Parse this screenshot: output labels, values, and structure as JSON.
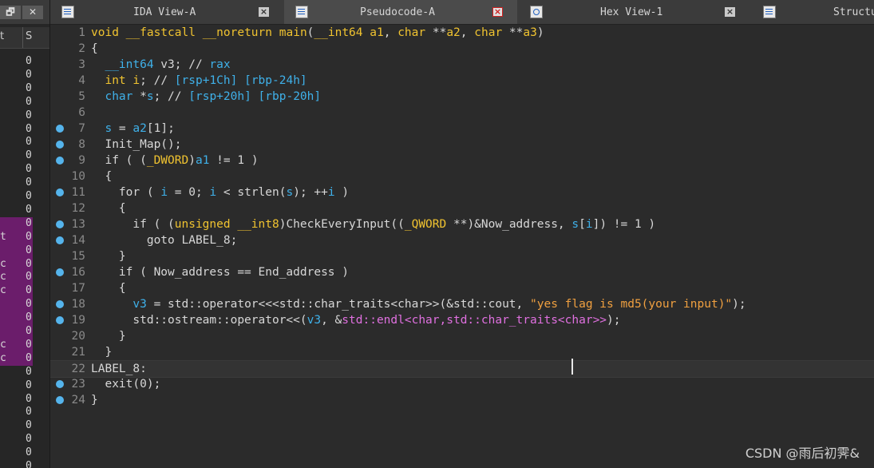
{
  "left_panel": {
    "btn1": "🗗",
    "btn2": "✕",
    "col_headers": [
      "t",
      "S"
    ],
    "rows": [
      {
        "c1": "",
        "c2": "0"
      },
      {
        "c1": "",
        "c2": "0"
      },
      {
        "c1": "",
        "c2": "0"
      },
      {
        "c1": "",
        "c2": "0"
      },
      {
        "c1": "",
        "c2": "0"
      },
      {
        "c1": "",
        "c2": "0"
      },
      {
        "c1": "",
        "c2": "0"
      },
      {
        "c1": "",
        "c2": "0"
      },
      {
        "c1": "",
        "c2": "0"
      },
      {
        "c1": "",
        "c2": "0"
      },
      {
        "c1": "",
        "c2": "0"
      },
      {
        "c1": "",
        "c2": "0"
      },
      {
        "c1": "",
        "c2": "0"
      },
      {
        "c1": "t",
        "c2": "0"
      },
      {
        "c1": "",
        "c2": "0"
      },
      {
        "c1": "c",
        "c2": "0"
      },
      {
        "c1": "c",
        "c2": "0"
      },
      {
        "c1": "c",
        "c2": "0"
      },
      {
        "c1": "",
        "c2": "0"
      },
      {
        "c1": "",
        "c2": "0"
      },
      {
        "c1": "",
        "c2": "0"
      },
      {
        "c1": "c",
        "c2": "0"
      },
      {
        "c1": "c",
        "c2": "0"
      },
      {
        "c1": "",
        "c2": "0"
      },
      {
        "c1": "",
        "c2": "0"
      },
      {
        "c1": "",
        "c2": "0"
      },
      {
        "c1": "",
        "c2": "0"
      },
      {
        "c1": "",
        "c2": "0"
      },
      {
        "c1": "",
        "c2": "0"
      },
      {
        "c1": "",
        "c2": "0"
      },
      {
        "c1": "",
        "c2": "0"
      },
      {
        "c1": "",
        "c2": "0"
      }
    ]
  },
  "tabs": [
    {
      "label": "IDA View-A",
      "icon": "ida-view-icon",
      "active": false
    },
    {
      "label": "Pseudocode-A",
      "icon": "pseudocode-icon",
      "active": true
    },
    {
      "label": "Hex View-1",
      "icon": "hex-view-icon",
      "active": false
    },
    {
      "label": "Structu",
      "icon": "structures-icon",
      "active": false
    }
  ],
  "close_glyph": "×",
  "code_lines": [
    {
      "n": "1",
      "bp": false,
      "tokens": [
        [
          "kw",
          "void"
        ],
        [
          "plain",
          " "
        ],
        [
          "kw",
          "__fastcall"
        ],
        [
          "plain",
          " "
        ],
        [
          "kw",
          "__noreturn"
        ],
        [
          "plain",
          " "
        ],
        [
          "kw",
          "main"
        ],
        [
          "plain",
          "("
        ],
        [
          "kw",
          "__int64"
        ],
        [
          "plain",
          " "
        ],
        [
          "kw",
          "a1"
        ],
        [
          "plain",
          ", "
        ],
        [
          "kw",
          "char"
        ],
        [
          "plain",
          " **"
        ],
        [
          "kw",
          "a2"
        ],
        [
          "plain",
          ", "
        ],
        [
          "kw",
          "char"
        ],
        [
          "plain",
          " **"
        ],
        [
          "kw",
          "a3"
        ],
        [
          "plain",
          ")"
        ]
      ]
    },
    {
      "n": "2",
      "bp": false,
      "tokens": [
        [
          "plain",
          "{"
        ]
      ]
    },
    {
      "n": "3",
      "bp": false,
      "tokens": [
        [
          "plain",
          "  "
        ],
        [
          "var",
          "__int64"
        ],
        [
          "plain",
          " v3; // "
        ],
        [
          "reg",
          "rax"
        ]
      ]
    },
    {
      "n": "4",
      "bp": false,
      "tokens": [
        [
          "plain",
          "  "
        ],
        [
          "kw",
          "int"
        ],
        [
          "plain",
          " "
        ],
        [
          "kw",
          "i"
        ],
        [
          "plain",
          "; // "
        ],
        [
          "reg",
          "[rsp+1Ch] [rbp-24h]"
        ]
      ]
    },
    {
      "n": "5",
      "bp": false,
      "tokens": [
        [
          "plain",
          "  "
        ],
        [
          "var",
          "char"
        ],
        [
          "plain",
          " *"
        ],
        [
          "var",
          "s"
        ],
        [
          "plain",
          "; // "
        ],
        [
          "reg",
          "[rsp+20h] [rbp-20h]"
        ]
      ]
    },
    {
      "n": "6",
      "bp": false,
      "tokens": [
        [
          "plain",
          ""
        ]
      ]
    },
    {
      "n": "7",
      "bp": true,
      "tokens": [
        [
          "plain",
          "  "
        ],
        [
          "var",
          "s"
        ],
        [
          "plain",
          " = "
        ],
        [
          "var",
          "a2"
        ],
        [
          "plain",
          "[1];"
        ]
      ]
    },
    {
      "n": "8",
      "bp": true,
      "tokens": [
        [
          "plain",
          "  Init_Map();"
        ]
      ]
    },
    {
      "n": "9",
      "bp": true,
      "tokens": [
        [
          "plain",
          "  if ( ("
        ],
        [
          "kw",
          "_DWORD"
        ],
        [
          "plain",
          ")"
        ],
        [
          "var",
          "a1"
        ],
        [
          "plain",
          " != 1 )"
        ]
      ]
    },
    {
      "n": "10",
      "bp": false,
      "tokens": [
        [
          "plain",
          "  {"
        ]
      ]
    },
    {
      "n": "11",
      "bp": true,
      "tokens": [
        [
          "plain",
          "    for ( "
        ],
        [
          "var",
          "i"
        ],
        [
          "plain",
          " = 0; "
        ],
        [
          "var",
          "i"
        ],
        [
          "plain",
          " < strlen("
        ],
        [
          "var",
          "s"
        ],
        [
          "plain",
          "); ++"
        ],
        [
          "var",
          "i"
        ],
        [
          "plain",
          " )"
        ]
      ]
    },
    {
      "n": "12",
      "bp": false,
      "tokens": [
        [
          "plain",
          "    {"
        ]
      ]
    },
    {
      "n": "13",
      "bp": true,
      "tokens": [
        [
          "plain",
          "      if ( ("
        ],
        [
          "kw",
          "unsigned __int8"
        ],
        [
          "plain",
          ")CheckEveryInput(("
        ],
        [
          "kw",
          "_QWORD"
        ],
        [
          "plain",
          " **)&Now_address, "
        ],
        [
          "var",
          "s"
        ],
        [
          "plain",
          "["
        ],
        [
          "var",
          "i"
        ],
        [
          "plain",
          "]) != 1 )"
        ]
      ]
    },
    {
      "n": "14",
      "bp": true,
      "tokens": [
        [
          "plain",
          "        goto LABEL_8;"
        ]
      ]
    },
    {
      "n": "15",
      "bp": false,
      "tokens": [
        [
          "plain",
          "    }"
        ]
      ]
    },
    {
      "n": "16",
      "bp": true,
      "tokens": [
        [
          "plain",
          "    if ( Now_address == End_address )"
        ]
      ]
    },
    {
      "n": "17",
      "bp": false,
      "tokens": [
        [
          "plain",
          "    {"
        ]
      ]
    },
    {
      "n": "18",
      "bp": true,
      "tokens": [
        [
          "plain",
          "      "
        ],
        [
          "var",
          "v3"
        ],
        [
          "plain",
          " = std::operator<<<std::char_traits<char>>(&std::cout, "
        ],
        [
          "str",
          "\"yes flag is md5(your input)\""
        ],
        [
          "plain",
          ");"
        ]
      ]
    },
    {
      "n": "19",
      "bp": true,
      "tokens": [
        [
          "plain",
          "      std::ostream::operator<<("
        ],
        [
          "var",
          "v3"
        ],
        [
          "plain",
          ", &"
        ],
        [
          "macro",
          "std::endl<char,std::char_traits<char>>"
        ],
        [
          "plain",
          ");"
        ]
      ]
    },
    {
      "n": "20",
      "bp": false,
      "tokens": [
        [
          "plain",
          "    }"
        ]
      ]
    },
    {
      "n": "21",
      "bp": false,
      "tokens": [
        [
          "plain",
          "  }"
        ]
      ]
    },
    {
      "n": "22",
      "bp": false,
      "cur": true,
      "tokens": [
        [
          "plain",
          "LABEL_8:"
        ]
      ]
    },
    {
      "n": "23",
      "bp": true,
      "tokens": [
        [
          "plain",
          "  exit(0);"
        ]
      ]
    },
    {
      "n": "24",
      "bp": true,
      "tokens": [
        [
          "plain",
          "}"
        ]
      ]
    }
  ],
  "watermark": "CSDN @雨后初霁&",
  "colors": {
    "background": "#2b2b2b",
    "keyword": "#f0c330",
    "variable": "#3fb1ea",
    "string": "#f0a040",
    "macro": "#e070e0",
    "breakpoint": "#55b4ec",
    "highlight_purple": "#6a1b6a"
  }
}
